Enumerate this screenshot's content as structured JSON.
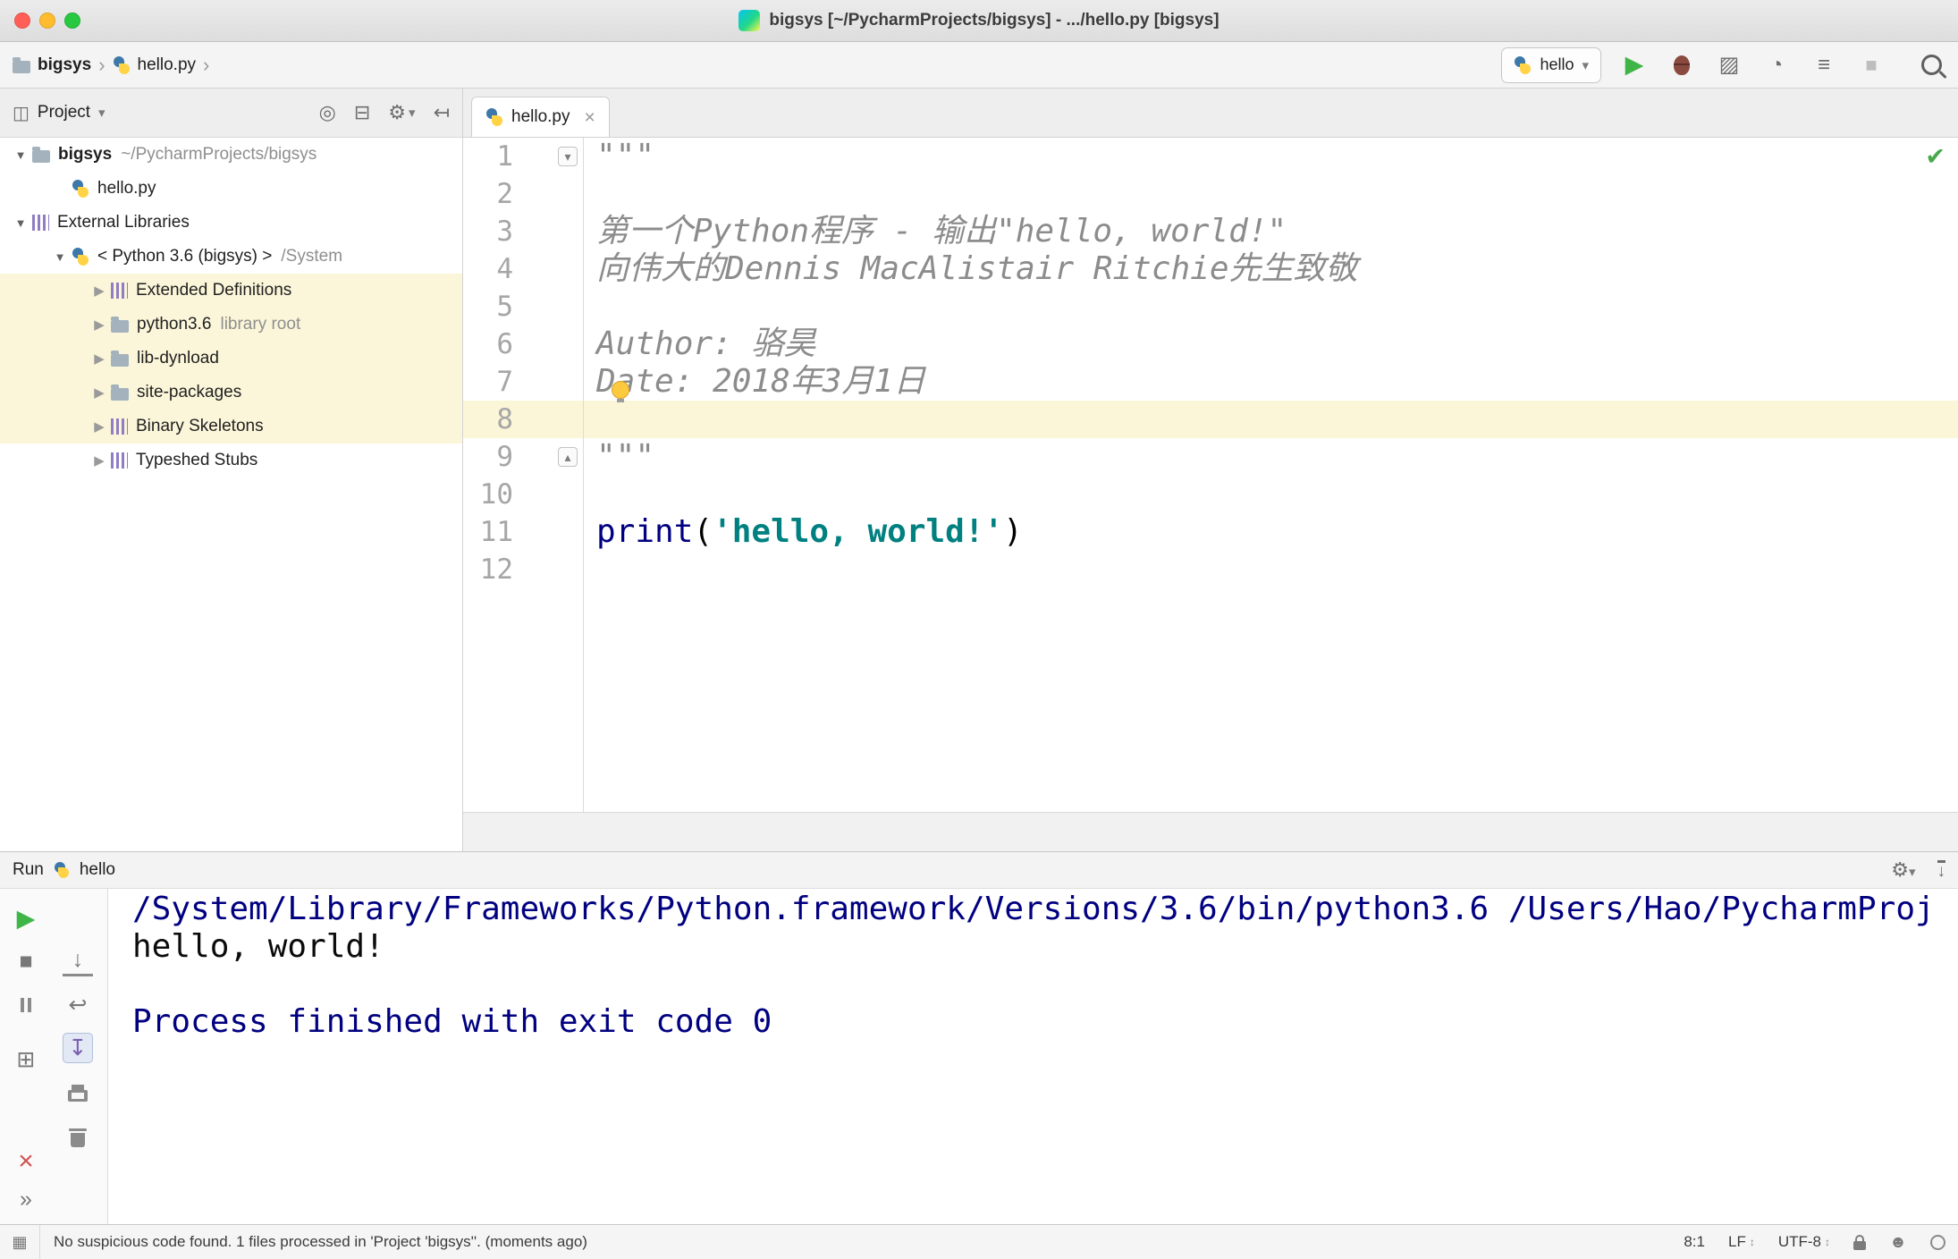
{
  "title_bar": {
    "title": "bigsys [~/PycharmProjects/bigsys] - .../hello.py [bigsys]"
  },
  "toolbar": {
    "breadcrumbs": [
      {
        "label": "bigsys",
        "icon": "folder",
        "bold": true
      },
      {
        "label": "hello.py",
        "icon": "python",
        "bold": false
      }
    ],
    "run_config": {
      "label": "hello"
    }
  },
  "project_panel": {
    "title": "Project",
    "tree": [
      {
        "label": "bigsys",
        "suffix": "~/PycharmProjects/bigsys",
        "icon": "folder",
        "arrow": "expanded",
        "level": 0,
        "bold": true,
        "highlight": false
      },
      {
        "label": "hello.py",
        "icon": "python-file",
        "arrow": "none",
        "level": 1,
        "bold": false,
        "highlight": false
      },
      {
        "label": "External Libraries",
        "icon": "library",
        "arrow": "expanded",
        "level": 0,
        "bold": false,
        "highlight": false
      },
      {
        "label": "< Python 3.6 (bigsys) >",
        "suffix": "/System",
        "icon": "python",
        "arrow": "expanded",
        "level": 1,
        "bold": false,
        "highlight": false
      },
      {
        "label": "Extended Definitions",
        "icon": "library",
        "arrow": "collapsed",
        "level": 2,
        "bold": false,
        "highlight": true
      },
      {
        "label": "python3.6",
        "suffix": "library root",
        "icon": "folder",
        "arrow": "collapsed",
        "level": 2,
        "bold": false,
        "highlight": true
      },
      {
        "label": "lib-dynload",
        "icon": "folder",
        "arrow": "collapsed",
        "level": 2,
        "bold": false,
        "highlight": true
      },
      {
        "label": "site-packages",
        "icon": "folder",
        "arrow": "collapsed",
        "level": 2,
        "bold": false,
        "highlight": true
      },
      {
        "label": "Binary Skeletons",
        "icon": "library",
        "arrow": "collapsed",
        "level": 2,
        "bold": false,
        "highlight": true
      },
      {
        "label": "Typeshed Stubs",
        "icon": "library",
        "arrow": "collapsed",
        "level": 2,
        "bold": false,
        "highlight": false
      }
    ]
  },
  "editor": {
    "tab": {
      "label": "hello.py"
    },
    "active_line": 8,
    "lines": [
      {
        "n": 1,
        "fold": "open",
        "tokens": [
          {
            "t": "\"\"\"",
            "c": "docstring"
          }
        ]
      },
      {
        "n": 2,
        "tokens": []
      },
      {
        "n": 3,
        "tokens": [
          {
            "t": "第一个Python程序 - 输出\"hello, world!\"",
            "c": "docstring"
          }
        ]
      },
      {
        "n": 4,
        "tokens": [
          {
            "t": "向伟大的Dennis MacAlistair Ritchie先生致敬",
            "c": "docstring"
          }
        ]
      },
      {
        "n": 5,
        "tokens": []
      },
      {
        "n": 6,
        "tokens": [
          {
            "t": "Author: 骆昊",
            "c": "docstring"
          }
        ]
      },
      {
        "n": 7,
        "bulb": true,
        "tokens": [
          {
            "t": "Date: 2018年3月1日",
            "c": "docstring"
          }
        ]
      },
      {
        "n": 8,
        "tokens": []
      },
      {
        "n": 9,
        "fold": "close",
        "tokens": [
          {
            "t": "\"\"\"",
            "c": "docstring"
          }
        ]
      },
      {
        "n": 10,
        "tokens": []
      },
      {
        "n": 11,
        "tokens": [
          {
            "t": "print",
            "c": "keyword"
          },
          {
            "t": "(",
            "c": "plain"
          },
          {
            "t": "'hello, world!'",
            "c": "string"
          },
          {
            "t": ")",
            "c": "plain"
          }
        ]
      },
      {
        "n": 12,
        "tokens": []
      }
    ]
  },
  "run_panel": {
    "title": "Run",
    "config": "hello",
    "console": [
      {
        "text": "/System/Library/Frameworks/Python.framework/Versions/3.6/bin/python3.6 /Users/Hao/PycharmProj",
        "color": "system"
      },
      {
        "text": "hello, world!",
        "color": "stdout"
      },
      {
        "text": "",
        "color": "stdout"
      },
      {
        "text": "Process finished with exit code 0",
        "color": "system"
      }
    ]
  },
  "status_bar": {
    "message": "No suspicious code found. 1 files processed in 'Project 'bigsys''. (moments ago)",
    "caret": "8:1",
    "line_ending": "LF",
    "encoding": "UTF-8"
  },
  "colors": {
    "docstring": "#8c8c8c",
    "keyword": "#000080",
    "string": "#008080",
    "plain": "#000000",
    "console_system": "#000080",
    "console_stdout": "#0b0b0b",
    "accent_green": "#3fb548",
    "highlight_row": "#fbf6d9",
    "active_line": "#fcf6d8",
    "traffic_red": "#ff5f57",
    "traffic_yellow": "#febc2e",
    "traffic_green": "#28c840"
  },
  "icons": {
    "expanded_arrow": "▼",
    "collapsed_arrow": "▶",
    "chevron": "›",
    "dropdown_caret": "▾",
    "run": "▶",
    "stop": "■",
    "restore_layout": "⊞",
    "close": "×",
    "more": "»",
    "scroll_down": "↓",
    "soft_wrap": "↩",
    "scroll_end": "↧",
    "locate": "◎",
    "collapse_all": "⊟",
    "settings": "⚙",
    "hide_panel": "↤",
    "coverage": "▨",
    "profiler": "◔",
    "concurrency": "≡",
    "check": "✔",
    "tool_grid": "▦",
    "updown": "↕",
    "hector": "☻",
    "panel_window": "◫",
    "fold_open": "▾",
    "fold_close": "▴",
    "hide_down": "↓"
  }
}
